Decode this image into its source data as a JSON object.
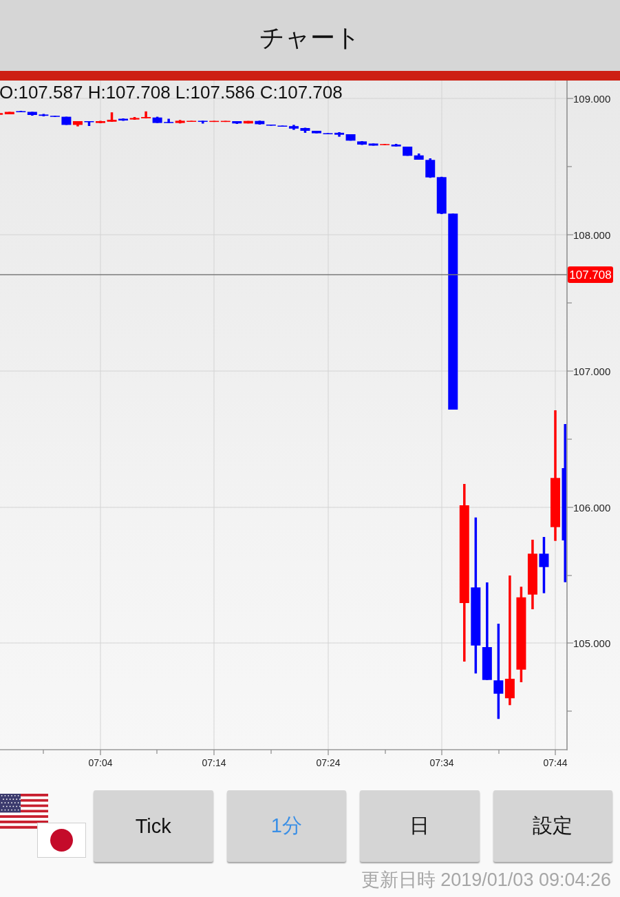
{
  "header": {
    "title": "チャート"
  },
  "chart": {
    "ohlc": "O:107.587 H:107.708 L:107.586 C:107.708",
    "price_axis_labels": [
      "109.000",
      "108.000",
      "107.000",
      "106.000",
      "105.000"
    ],
    "current_price": "107.708",
    "time_axis_labels": [
      "07:04",
      "07:14",
      "07:24",
      "07:34",
      "07:44"
    ]
  },
  "timeframe_buttons": [
    {
      "label": "Tick",
      "selected": false
    },
    {
      "label": "1分",
      "selected": true
    },
    {
      "label": "日",
      "selected": false
    }
  ],
  "settings_button": {
    "label": "設定"
  },
  "updated_at": "更新日時 2019/01/03 09:04:26"
}
